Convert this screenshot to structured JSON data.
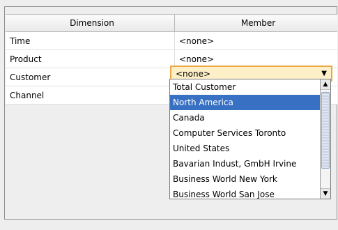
{
  "table": {
    "headers": [
      "Dimension",
      "Member"
    ],
    "rows": [
      {
        "dimension": "Time",
        "member": "<none>"
      },
      {
        "dimension": "Product",
        "member": "<none>"
      },
      {
        "dimension": "Customer",
        "member": "<none>"
      },
      {
        "dimension": "Channel",
        "member": ""
      }
    ]
  },
  "combo": {
    "value": "<none>"
  },
  "dropdown": {
    "selected": "North America",
    "options": [
      "Total Customer",
      "North America",
      "Canada",
      "Computer Services Toronto",
      "United States",
      "Bavarian Indust, GmbH Irvine",
      "Business World New York",
      "Business World San Jose"
    ]
  },
  "colors": {
    "selection": "#3870c3",
    "combo_border": "#e9aa46",
    "combo_bg": "#fdefc8"
  },
  "icons": {
    "combo_arrow": "triangle-down-icon",
    "scroll_up": "scroll-up-icon",
    "scroll_down": "scroll-down-icon"
  }
}
